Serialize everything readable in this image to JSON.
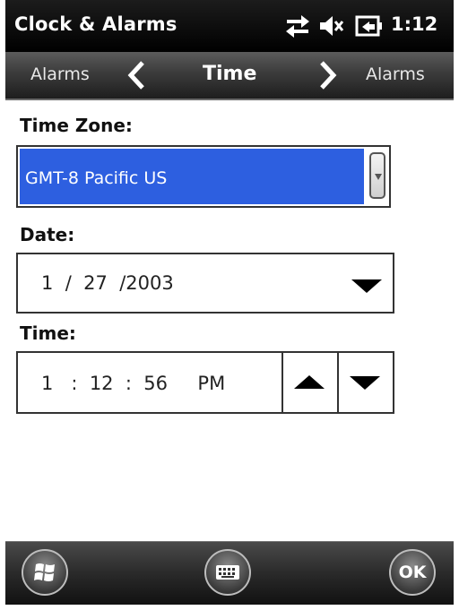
{
  "status_bar": {
    "title": "Clock & Alarms",
    "time": "1:12"
  },
  "nav": {
    "prev_label": "Alarms",
    "current_label": "Time",
    "next_label": "Alarms"
  },
  "time_zone": {
    "label": "Time Zone:",
    "value": "GMT-8 Pacific US"
  },
  "date": {
    "label": "Date:",
    "value": "1  /  27  /2003"
  },
  "time": {
    "label": "Time:",
    "value": "1   :  12  :  56     PM"
  },
  "softkeys": {
    "ok_label": "OK"
  },
  "colors": {
    "selection": "#2d5fe0",
    "bar_dark": "#1e1e1e",
    "background": "#ffffff"
  },
  "icons": {
    "connectivity": "connectivity-arrows-icon",
    "volume": "speaker-muted-icon",
    "battery": "battery-plug-icon",
    "start": "windows-flag-icon",
    "keyboard": "keyboard-icon"
  }
}
